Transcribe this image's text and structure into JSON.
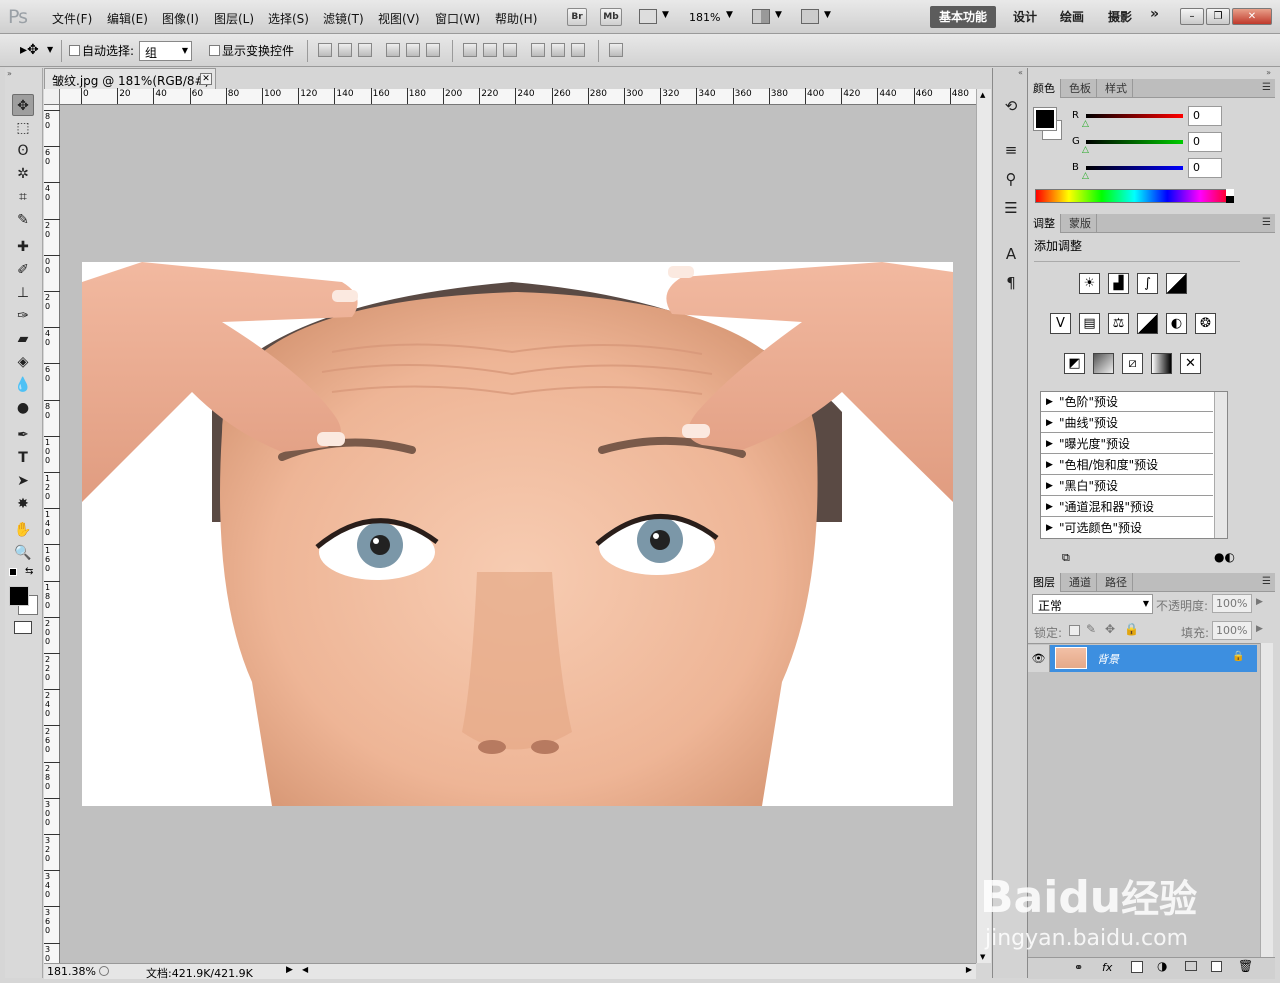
{
  "app": {
    "logo": "Ps"
  },
  "menu": [
    "文件(F)",
    "编辑(E)",
    "图像(I)",
    "图层(L)",
    "选择(S)",
    "滤镜(T)",
    "视图(V)",
    "窗口(W)",
    "帮助(H)"
  ],
  "appbar": {
    "br": "Br",
    "mb": "Mb",
    "zoom": "181%"
  },
  "workspaces": {
    "active": "基本功能",
    "items": [
      "设计",
      "绘画",
      "摄影"
    ],
    "more": "»"
  },
  "window_controls": {
    "minimize": "–",
    "restore": "❐",
    "close": "✕"
  },
  "options": {
    "auto_select_label": "自动选择:",
    "auto_select_value": "组",
    "show_transform_label": "显示变换控件"
  },
  "document": {
    "tab_title": "皱纹.jpg @ 181%(RGB/8#)",
    "close": "✕"
  },
  "ruler": {
    "h_labels": [
      "0",
      "20",
      "40",
      "60",
      "80",
      "100",
      "120",
      "140",
      "160",
      "180",
      "200",
      "220",
      "240",
      "260",
      "280",
      "300",
      "320",
      "340",
      "360",
      "380",
      "400",
      "420",
      "440",
      "460",
      "480"
    ],
    "v_labels": [
      "8",
      "6",
      "4",
      "2",
      "0",
      "2",
      "4",
      "6",
      "8",
      "10",
      "12",
      "14",
      "16",
      "18",
      "20",
      "22",
      "24",
      "26",
      "28",
      "30",
      "32",
      "34",
      "36",
      "3"
    ]
  },
  "status": {
    "zoom": "181.38%",
    "doc": "文档:421.9K/421.9K"
  },
  "color_panel": {
    "tabs": [
      "颜色",
      "色板",
      "样式"
    ],
    "channels": [
      {
        "label": "R",
        "value": "0"
      },
      {
        "label": "G",
        "value": "0"
      },
      {
        "label": "B",
        "value": "0"
      }
    ]
  },
  "adjust_panel": {
    "tabs": [
      "调整",
      "蒙版"
    ],
    "title": "添加调整",
    "presets": [
      "\"色阶\"预设",
      "\"曲线\"预设",
      "\"曝光度\"预设",
      "\"色相/饱和度\"预设",
      "\"黑白\"预设",
      "\"通道混和器\"预设",
      "\"可选颜色\"预设"
    ]
  },
  "layers_panel": {
    "tabs": [
      "图层",
      "通道",
      "路径"
    ],
    "blend_mode": "正常",
    "opacity_label": "不透明度:",
    "opacity_value": "100%",
    "lock_label": "锁定:",
    "fill_label": "填充:",
    "fill_value": "100%",
    "layers": [
      {
        "name": "背景"
      }
    ],
    "footer_icons": [
      "link-icon",
      "fx-icon",
      "mask-icon",
      "adjustment-icon",
      "group-icon",
      "new-layer-icon",
      "trash-icon"
    ]
  },
  "watermark": {
    "brand": "Bai",
    "brand2": "du",
    "product": "经验",
    "url": "jingyan.baidu.com"
  }
}
